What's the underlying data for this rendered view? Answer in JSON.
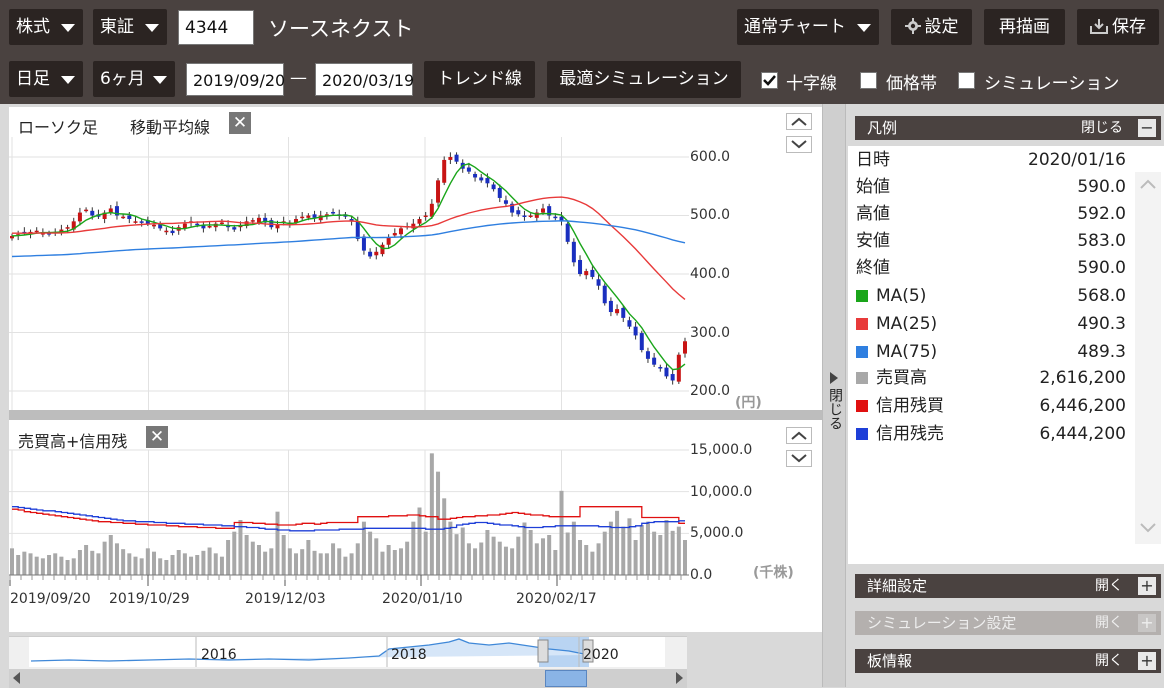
{
  "toolbar1": {
    "market": "株式",
    "exchange": "東証",
    "code": "4344",
    "company": "ソースネクスト",
    "chart_mode": "通常チャート",
    "settings": "設定",
    "redraw": "再描画",
    "save": "保存"
  },
  "toolbar2": {
    "period": "日足",
    "range": "6ヶ月",
    "date_from": "2019/09/20",
    "dash": "—",
    "date_to": "2020/03/19",
    "trendline": "トレンド線",
    "optimal_sim": "最適シミュレーション",
    "crosshair": "十字線",
    "price_band": "価格帯",
    "simulation": "シミュレーション"
  },
  "price_panel": {
    "title": "ローソク足",
    "ma_label": "移動平均線",
    "y_ticks": [
      "600.0",
      "500.0",
      "400.0",
      "300.0",
      "200.0"
    ],
    "unit": "(円)"
  },
  "volume_panel": {
    "title": "売買高+信用残",
    "y_ticks": [
      "15,000.0",
      "10,000.0",
      "5,000.0",
      "0.0"
    ],
    "unit": "(千株)"
  },
  "x_labels": [
    "2019/09/20",
    "2019/10/29",
    "2019/12/03",
    "2020/01/10",
    "2020/02/17"
  ],
  "navigator": {
    "years": [
      "2016",
      "2018",
      "2020"
    ]
  },
  "side_toggle": "閉じる",
  "legend": {
    "title": "凡例",
    "close": "閉じる",
    "rows": [
      {
        "key": "日時",
        "value": "2020/01/16"
      },
      {
        "key": "始値",
        "value": "590.0"
      },
      {
        "key": "高値",
        "value": "592.0"
      },
      {
        "key": "安値",
        "value": "583.0"
      },
      {
        "key": "終値",
        "value": "590.0"
      },
      {
        "key": "MA(5)",
        "value": "568.0",
        "color": "#1aa51a"
      },
      {
        "key": "MA(25)",
        "value": "490.3",
        "color": "#e83a3a"
      },
      {
        "key": "MA(75)",
        "value": "489.3",
        "color": "#2f7fe0"
      },
      {
        "key": "売買高",
        "value": "2,616,200",
        "color": "#a8a8a8"
      },
      {
        "key": "信用残買",
        "value": "6,446,200",
        "color": "#e01010"
      },
      {
        "key": "信用残売",
        "value": "6,444,200",
        "color": "#1e3fd8"
      }
    ]
  },
  "sections": [
    {
      "title": "詳細設定",
      "action": "開く"
    },
    {
      "title": "シミュレーション設定",
      "action": "開く"
    },
    {
      "title": "板情報",
      "action": "開く"
    }
  ],
  "chart_data": {
    "type": "candlestick",
    "y_range": [
      200,
      600
    ],
    "ma": [
      {
        "name": "MA(5)",
        "color": "#1aa51a"
      },
      {
        "name": "MA(25)",
        "color": "#e83a3a"
      },
      {
        "name": "MA(75)",
        "color": "#2f7fe0"
      }
    ],
    "closes": [
      465,
      468,
      470,
      472,
      474,
      470,
      468,
      472,
      476,
      480,
      490,
      505,
      510,
      500,
      498,
      505,
      512,
      500,
      498,
      494,
      490,
      488,
      486,
      484,
      478,
      474,
      470,
      480,
      486,
      490,
      484,
      478,
      482,
      486,
      488,
      480,
      476,
      484,
      490,
      492,
      496,
      488,
      480,
      485,
      490,
      488,
      494,
      498,
      500,
      496,
      500,
      502,
      504,
      500,
      498,
      490,
      460,
      440,
      430,
      438,
      450,
      462,
      470,
      478,
      482,
      486,
      494,
      500,
      520,
      560,
      595,
      600,
      592,
      580,
      575,
      565,
      560,
      555,
      545,
      530,
      520,
      505,
      502,
      498,
      500,
      505,
      512,
      500,
      496,
      490,
      455,
      420,
      400,
      405,
      395,
      380,
      350,
      335,
      340,
      325,
      310,
      295,
      270,
      255,
      245,
      240,
      225,
      218,
      262,
      285
    ],
    "volumes": [
      3200,
      2400,
      2800,
      2600,
      2200,
      2000,
      2400,
      2600,
      2200,
      1800,
      2000,
      3000,
      3600,
      2900,
      2600,
      4000,
      4800,
      3800,
      3100,
      2600,
      2200,
      2000,
      3200,
      2800,
      2000,
      1800,
      2400,
      3000,
      2600,
      2200,
      2400,
      2900,
      3300,
      2600,
      2200,
      4200,
      5200,
      6600,
      4800,
      4000,
      3600,
      2800,
      3200,
      7600,
      4800,
      3200,
      2600,
      3100,
      4200,
      2900,
      2600,
      2600,
      3800,
      3200,
      2200,
      2600,
      3800,
      6400,
      5200,
      4400,
      2800,
      3600,
      3000,
      3200,
      4000,
      6400,
      8100,
      5200,
      14600,
      12400,
      9200,
      6400,
      4900,
      5700,
      3800,
      3200,
      3900,
      5400,
      4600,
      4000,
      3400,
      3200,
      4600,
      6300,
      5400,
      3800,
      4400,
      4800,
      3000,
      10100,
      5100,
      6400,
      4200,
      3600,
      2800,
      3800,
      5200,
      6400,
      7700,
      5800,
      6800,
      4200,
      6000,
      6400,
      5200,
      4800,
      6600,
      5300,
      5800,
      4200
    ],
    "margin_buy": [
      7900,
      7800,
      7600,
      7500,
      7400,
      7300,
      7200,
      7100,
      7000,
      6900,
      6800,
      6700,
      6600,
      6500,
      6400,
      6400,
      6300,
      6300,
      6200,
      6200,
      6100,
      6100,
      6000,
      6000,
      6000,
      5900,
      5900,
      5800,
      5800,
      5800,
      5700,
      5700,
      5700,
      5600,
      5600,
      5600,
      6300,
      6300,
      6300,
      6200,
      6200,
      6100,
      6100,
      6000,
      6000,
      6000,
      6100,
      6200,
      6200,
      6100,
      6200,
      6300,
      6300,
      6300,
      6300,
      6300,
      7000,
      7000,
      7000,
      7000,
      7000,
      7100,
      7100,
      7100,
      7200,
      7200,
      7100,
      7000,
      7000,
      6700,
      6700,
      6800,
      6900,
      7000,
      7000,
      7100,
      7100,
      7200,
      7200,
      7300,
      7400,
      7500,
      7400,
      7300,
      7200,
      7200,
      7100,
      7000,
      7000,
      7000,
      7000,
      7000,
      8200,
      8200,
      8200,
      8200,
      8200,
      8200,
      8200,
      8200,
      8200,
      8200,
      6900,
      6900,
      6900,
      6900,
      6900,
      6900,
      6200,
      6200
    ],
    "margin_sell": [
      8200,
      8100,
      8000,
      7900,
      7800,
      7700,
      7700,
      7600,
      7500,
      7400,
      7300,
      7200,
      7100,
      7000,
      6900,
      6800,
      6700,
      6600,
      6500,
      6500,
      6400,
      6400,
      6400,
      6300,
      6300,
      6200,
      6200,
      6200,
      6100,
      6100,
      6100,
      6000,
      6000,
      6000,
      5900,
      5900,
      5800,
      5800,
      5700,
      5700,
      5600,
      5500,
      5500,
      5400,
      5400,
      5300,
      5300,
      5300,
      5300,
      5400,
      5400,
      5400,
      5400,
      5500,
      5500,
      5500,
      5500,
      5600,
      5600,
      5600,
      5600,
      5600,
      5600,
      5600,
      5600,
      5600,
      5600,
      5500,
      5500,
      5500,
      5600,
      5700,
      6000,
      6100,
      6200,
      6300,
      6300,
      6200,
      6100,
      6000,
      6000,
      5900,
      5800,
      5700,
      5700,
      5700,
      5800,
      5800,
      5900,
      5900,
      5900,
      5900,
      5900,
      5900,
      5900,
      5800,
      5800,
      5700,
      5700,
      5700,
      5800,
      5900,
      6200,
      6300,
      6400,
      6400,
      6400,
      6400,
      6500,
      6500
    ]
  }
}
